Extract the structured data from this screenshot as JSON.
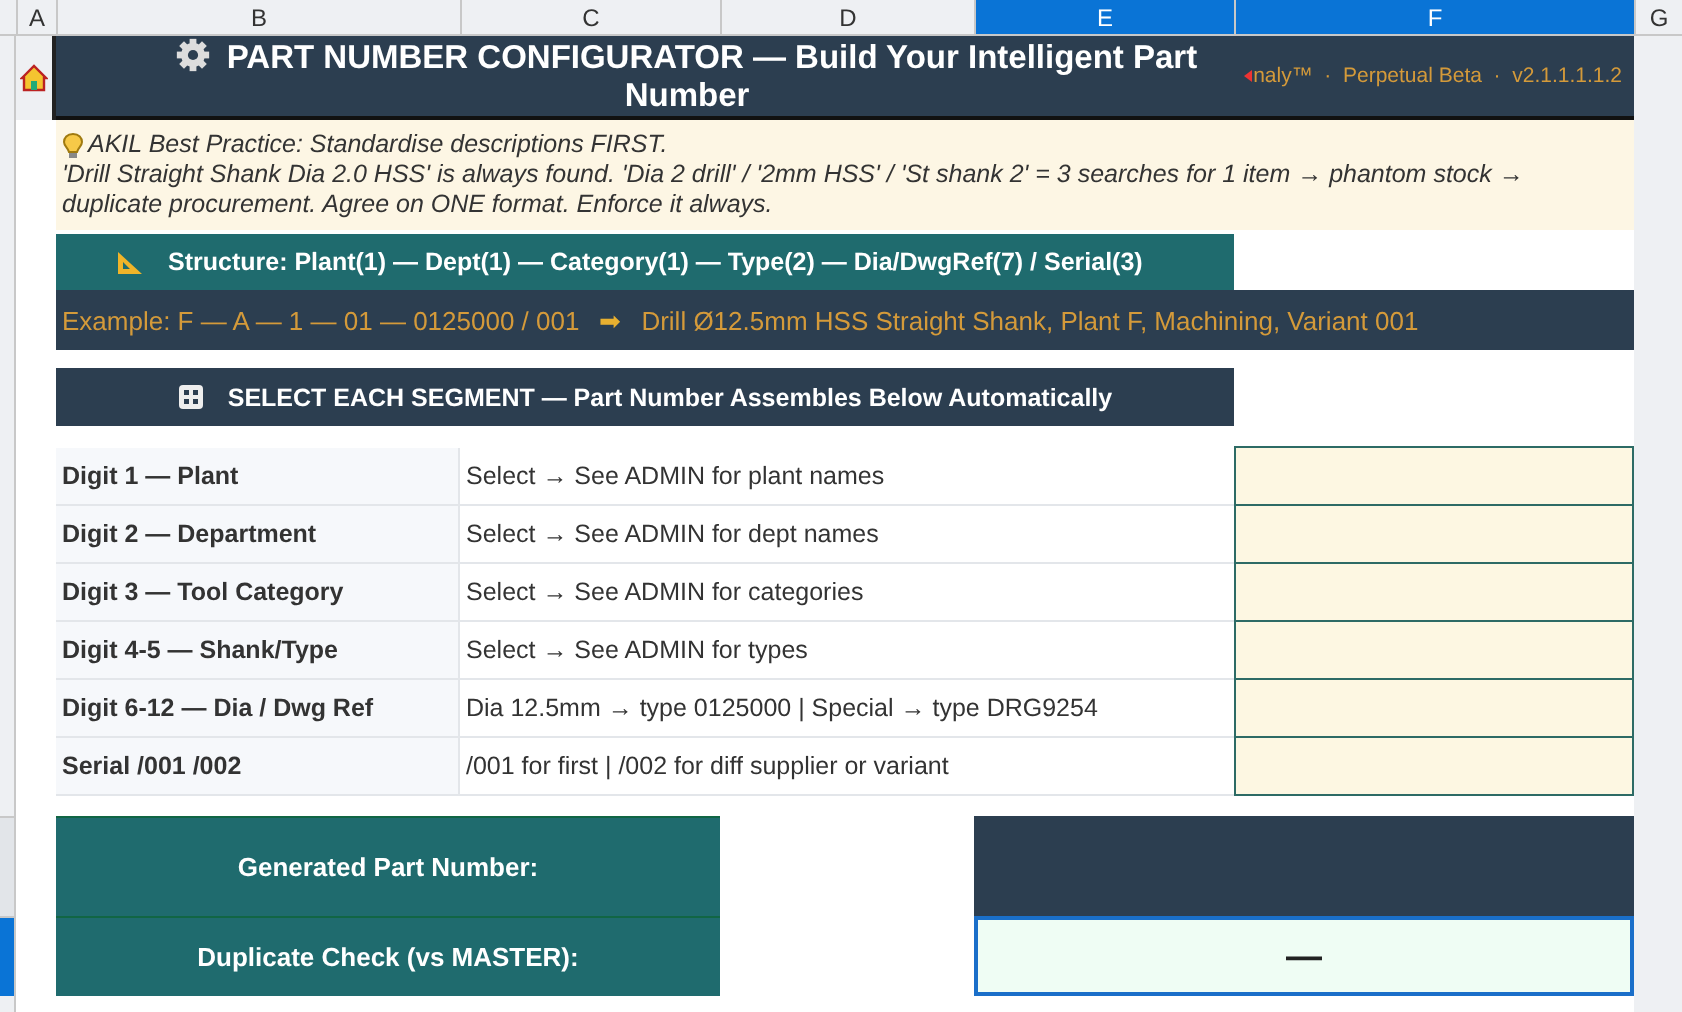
{
  "columns": [
    {
      "label": "A",
      "selected": false
    },
    {
      "label": "B",
      "selected": false
    },
    {
      "label": "C",
      "selected": false
    },
    {
      "label": "D",
      "selected": false
    },
    {
      "label": "E",
      "selected": true
    },
    {
      "label": "F",
      "selected": true
    },
    {
      "label": "G",
      "selected": false
    }
  ],
  "header": {
    "title": "PART NUMBER CONFIGURATOR — Build Your Intelligent Part Number",
    "brand": "naly™  ·  Perpetual Beta  ·  v2.1.1.1.1.2"
  },
  "note": {
    "heading": "AKIL Best Practice: Standardise descriptions FIRST.",
    "body": "'Drill Straight Shank Dia 2.0 HSS' is always found. 'Dia 2 drill' / '2mm HSS' / 'St shank 2' = 3 searches for 1 item → phantom stock → duplicate procurement. Agree on ONE format. Enforce it always."
  },
  "structure": "Structure: Plant(1) — Dept(1) — Category(1) — Type(2) — Dia/DwgRef(7) / Serial(3)",
  "example": {
    "label": "Example:  F — A — 1 — 01 — 0125000 / 001",
    "arrow": "➡",
    "meaning": "Drill Ø12.5mm HSS Straight Shank, Plant F, Machining, Variant 001"
  },
  "select_banner": "SELECT EACH SEGMENT — Part Number Assembles Below Automatically",
  "segments": [
    {
      "label": "Digit 1 — Plant",
      "hint": "Select → See ADMIN for plant names"
    },
    {
      "label": "Digit 2 — Department",
      "hint": "Select → See ADMIN for dept names"
    },
    {
      "label": "Digit 3 — Tool Category",
      "hint": "Select → See ADMIN for categories"
    },
    {
      "label": "Digit 4-5 — Shank/Type",
      "hint": "Select → See ADMIN for types"
    },
    {
      "label": "Digit 6-12 — Dia / Dwg Ref",
      "hint": "Dia 12.5mm → type 0125000  |  Special → type DRG9254"
    },
    {
      "label": "Serial  /001  /002",
      "hint": "/001 for first  |  /002 for diff supplier or variant"
    }
  ],
  "results": [
    {
      "label": "Generated Part Number:",
      "kind": "part",
      "selected": false
    },
    {
      "label": "Duplicate Check (vs MASTER):",
      "kind": "check",
      "value": "—",
      "selected": true
    }
  ]
}
